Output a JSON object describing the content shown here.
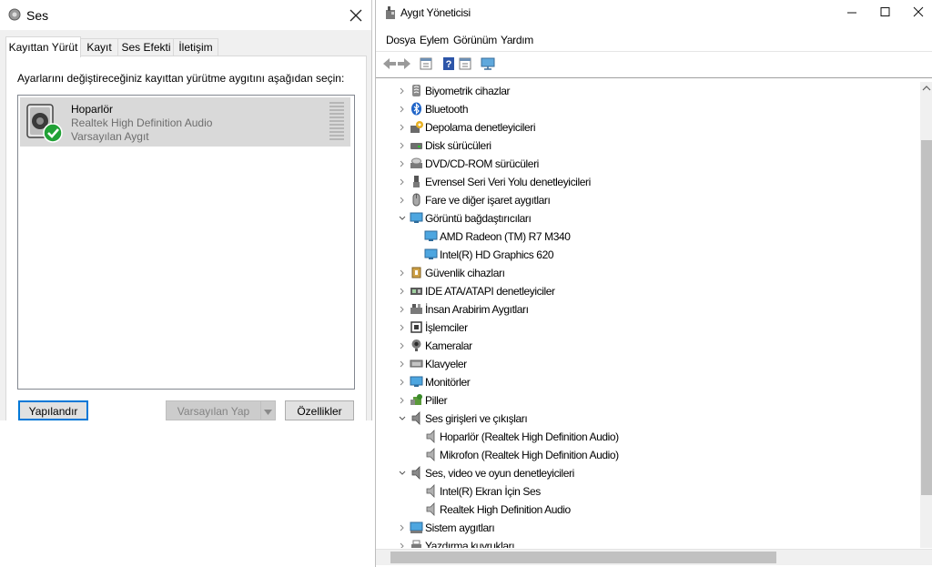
{
  "sound_dialog": {
    "title": "Ses",
    "tabs": [
      {
        "label": "Kayıttan Yürüt",
        "active": true
      },
      {
        "label": "Kayıt"
      },
      {
        "label": "Ses Efekti"
      },
      {
        "label": "İletişim"
      }
    ],
    "instruction": "Ayarlarını değiştireceğiniz kayıttan yürütme aygıtını aşağıdan seçin:",
    "device": {
      "name": "Hoparlör",
      "driver": "Realtek High Definition Audio",
      "status": "Varsayılan Aygıt"
    },
    "buttons": {
      "configure": "Yapılandır",
      "set_default": "Varsayılan Yap",
      "properties": "Özellikler"
    }
  },
  "device_manager": {
    "title": "Aygıt Yöneticisi",
    "menu": [
      "Dosya",
      "Eylem",
      "Görünüm",
      "Yardım"
    ],
    "tree": [
      {
        "label": "Biyometrik cihazlar",
        "level": 0,
        "expanded": false,
        "icon": "fingerprint-icon"
      },
      {
        "label": "Bluetooth",
        "level": 0,
        "expanded": false,
        "icon": "bluetooth-icon"
      },
      {
        "label": "Depolama denetleyicileri",
        "level": 0,
        "expanded": false,
        "icon": "storage-controller-icon"
      },
      {
        "label": "Disk sürücüleri",
        "level": 0,
        "expanded": false,
        "icon": "disk-drive-icon"
      },
      {
        "label": "DVD/CD-ROM sürücüleri",
        "level": 0,
        "expanded": false,
        "icon": "dvd-drive-icon"
      },
      {
        "label": "Evrensel Seri Veri Yolu denetleyicileri",
        "level": 0,
        "expanded": false,
        "icon": "usb-icon"
      },
      {
        "label": "Fare ve diğer işaret aygıtları",
        "level": 0,
        "expanded": false,
        "icon": "mouse-icon"
      },
      {
        "label": "Görüntü bağdaştırıcıları",
        "level": 0,
        "expanded": true,
        "icon": "display-adapter-icon"
      },
      {
        "label": "AMD Radeon (TM) R7 M340",
        "level": 1,
        "icon": "display-adapter-icon"
      },
      {
        "label": "Intel(R) HD Graphics 620",
        "level": 1,
        "icon": "display-adapter-icon"
      },
      {
        "label": "Güvenlik cihazları",
        "level": 0,
        "expanded": false,
        "icon": "security-device-icon"
      },
      {
        "label": "IDE ATA/ATAPI denetleyiciler",
        "level": 0,
        "expanded": false,
        "icon": "ide-controller-icon"
      },
      {
        "label": "İnsan Arabirim Aygıtları",
        "level": 0,
        "expanded": false,
        "icon": "hid-icon"
      },
      {
        "label": "İşlemciler",
        "level": 0,
        "expanded": false,
        "icon": "processor-icon"
      },
      {
        "label": "Kameralar",
        "level": 0,
        "expanded": false,
        "icon": "camera-icon"
      },
      {
        "label": "Klavyeler",
        "level": 0,
        "expanded": false,
        "icon": "keyboard-icon"
      },
      {
        "label": "Monitörler",
        "level": 0,
        "expanded": false,
        "icon": "monitor-icon"
      },
      {
        "label": "Piller",
        "level": 0,
        "expanded": false,
        "icon": "battery-icon"
      },
      {
        "label": "Ses girişleri ve çıkışları",
        "level": 0,
        "expanded": true,
        "icon": "audio-io-icon"
      },
      {
        "label": "Hoparlör (Realtek High Definition Audio)",
        "level": 1,
        "icon": "speaker-icon"
      },
      {
        "label": "Mikrofon (Realtek High Definition Audio)",
        "level": 1,
        "icon": "speaker-icon"
      },
      {
        "label": "Ses, video ve oyun denetleyicileri",
        "level": 0,
        "expanded": true,
        "icon": "audio-io-icon"
      },
      {
        "label": "Intel(R) Ekran İçin Ses",
        "level": 1,
        "icon": "speaker-icon"
      },
      {
        "label": "Realtek High Definition Audio",
        "level": 1,
        "icon": "speaker-icon"
      },
      {
        "label": "Sistem aygıtları",
        "level": 0,
        "expanded": false,
        "icon": "system-device-icon"
      },
      {
        "label": "Yazdırma kuyrukları",
        "level": 0,
        "expanded": false,
        "icon": "printer-icon"
      }
    ]
  }
}
